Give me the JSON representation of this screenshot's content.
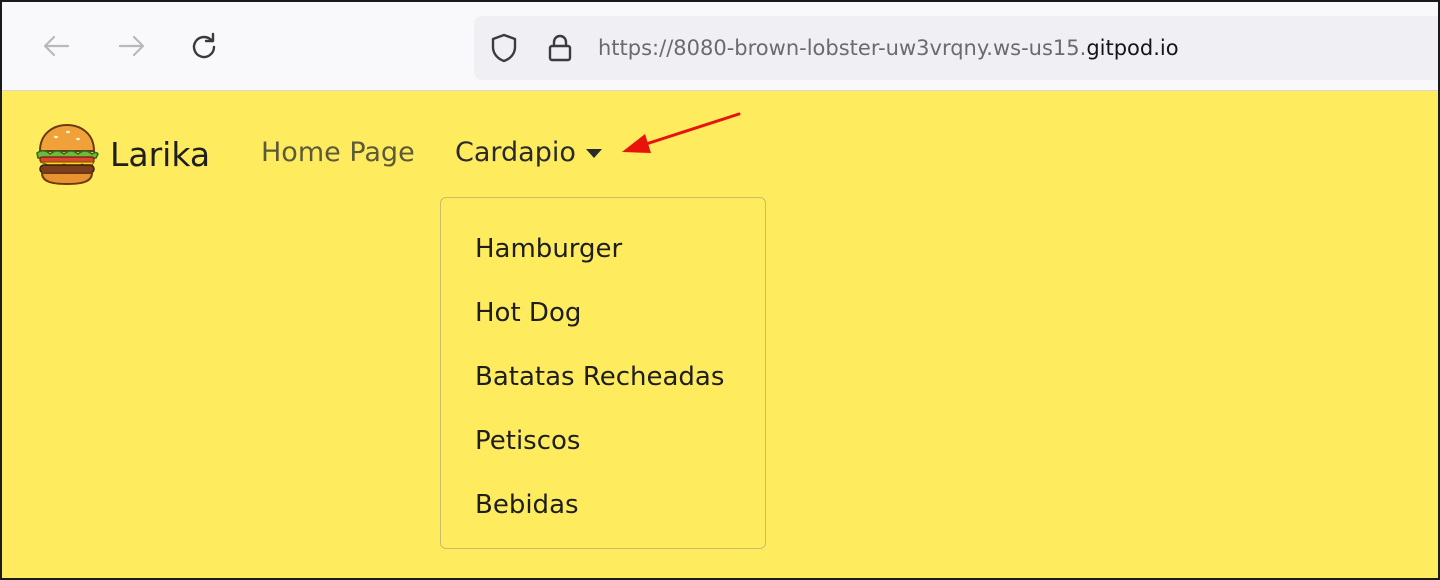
{
  "browser": {
    "url_prefix": "https://8080-brown-lobster-uw3vrqny.ws-us15.",
    "url_domain": "gitpod.io",
    "icons": {
      "back": "back-arrow-icon",
      "forward": "forward-arrow-icon",
      "reload": "reload-icon",
      "tracking": "shield-icon",
      "security": "lock-icon"
    }
  },
  "navbar": {
    "brand_name": "Larika",
    "brand_logo": "hamburger-logo",
    "links": {
      "home": "Home Page",
      "cardapio": "Cardapio"
    }
  },
  "dropdown": {
    "items": [
      "Hamburger",
      "Hot Dog",
      "Batatas Recheadas",
      "Petiscos",
      "Bebidas"
    ]
  },
  "colors": {
    "page_background": "#ffeb5e",
    "annotation_arrow": "#e8140c",
    "toolbar_background": "#f9f9fb"
  }
}
